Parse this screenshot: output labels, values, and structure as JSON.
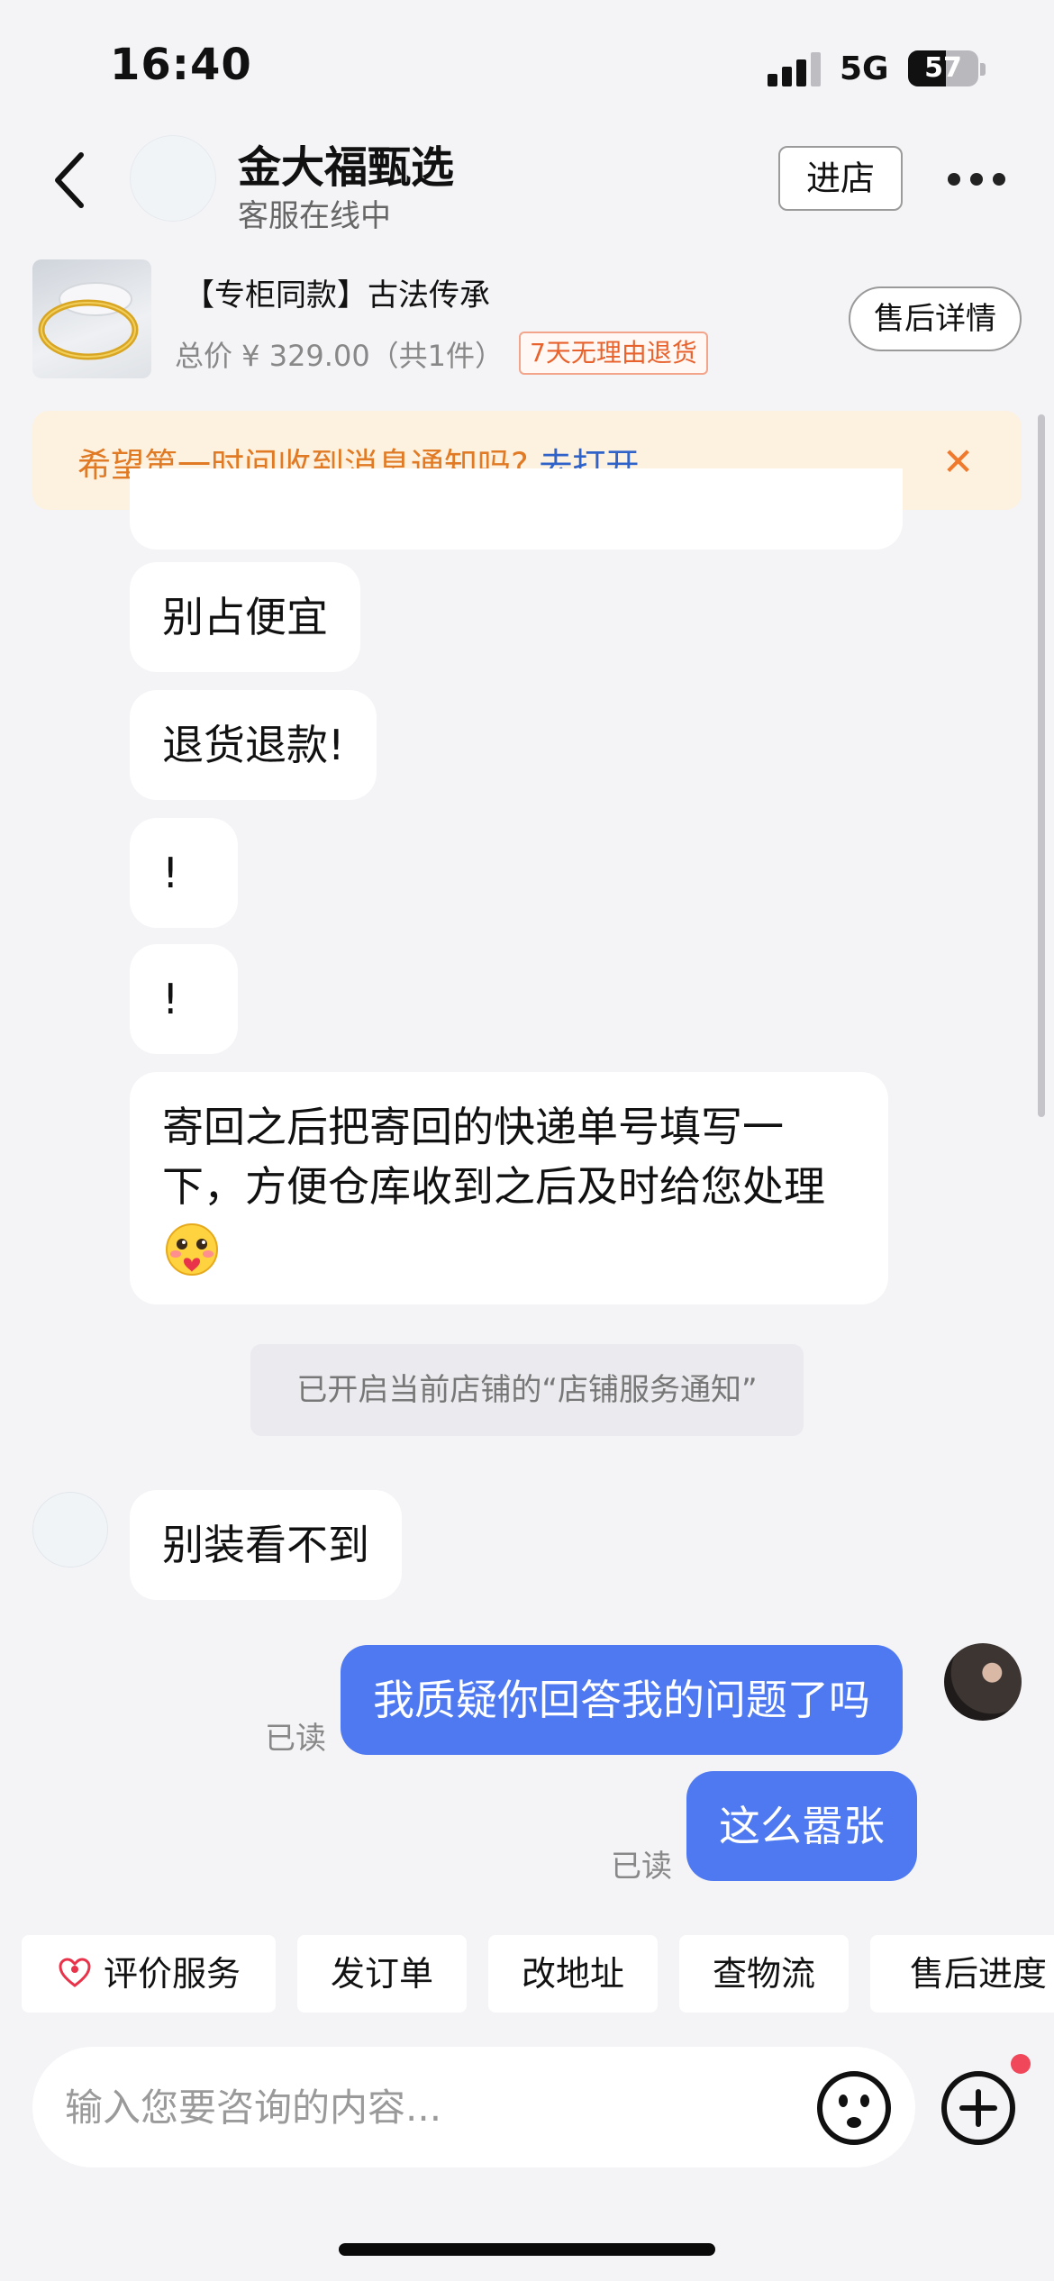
{
  "status_bar": {
    "time": "16:40",
    "network": "5G",
    "battery": "57"
  },
  "header": {
    "shop_name": "金大福甄选",
    "shop_status": "客服在线中",
    "enter_store": "进店"
  },
  "product": {
    "title": "【专柜同款】古法传承",
    "price": "总价 ¥ 329.00（共1件）",
    "return_tag": "7天无理由退货",
    "after_sale_button": "售后详情"
  },
  "notice": {
    "text": "希望第一时间收到消息通知吗?",
    "link": "去打开",
    "close": "✕"
  },
  "messages": {
    "m1": "别占便宜",
    "m2": "退货退款!",
    "m3": "!",
    "m4": "!",
    "m5_line1": "寄回之后把寄回的快递单号填写一",
    "m5_line2": "下，方便仓库收到之后及时给您处理",
    "system": "已开启当前店铺的“店铺服务通知”",
    "m6": "别装看不到",
    "out1": "我质疑你回答我的问题了吗",
    "out2": "这么嚣张",
    "read_label": "已读"
  },
  "quick_actions": [
    "评价服务",
    "发订单",
    "改地址",
    "查物流",
    "售后进度"
  ],
  "input": {
    "placeholder": "输入您要咨询的内容..."
  },
  "colors": {
    "accent": "#4f79f1",
    "notice_bg": "#fdf1e0",
    "notice_text": "#e07a24",
    "link": "#2f63c9"
  }
}
